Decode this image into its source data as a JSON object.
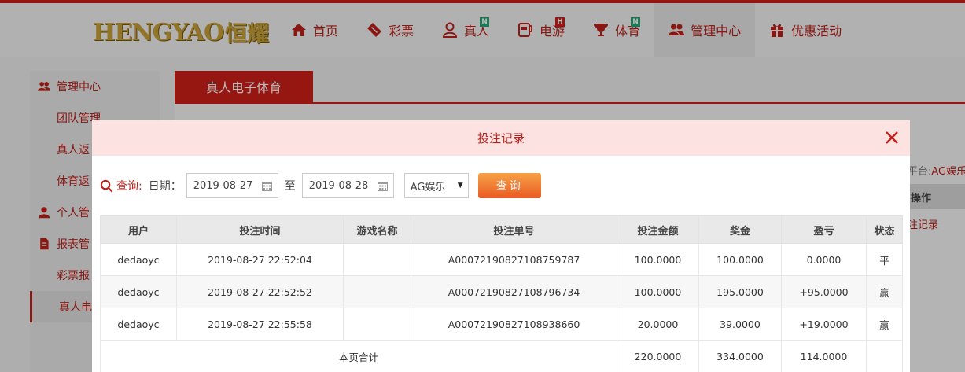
{
  "brand": {
    "logo_en": "HENGYAO",
    "logo_cn": "恒耀"
  },
  "nav": [
    {
      "label": "首页",
      "icon": "home-icon",
      "badge": ""
    },
    {
      "label": "彩票",
      "icon": "ticket-icon",
      "badge": ""
    },
    {
      "label": "真人",
      "icon": "live-dealer-icon",
      "badge": "N"
    },
    {
      "label": "电游",
      "icon": "slot-machine-icon",
      "badge": "H"
    },
    {
      "label": "体育",
      "icon": "trophy-icon",
      "badge": "N"
    },
    {
      "label": "管理中心",
      "icon": "users-icon",
      "badge": ""
    },
    {
      "label": "优惠活动",
      "icon": "gift-icon",
      "badge": ""
    }
  ],
  "sidebar": {
    "items": [
      {
        "label": "管理中心",
        "icon": "users-icon"
      },
      {
        "label": "团队管理"
      },
      {
        "label": "真人返"
      },
      {
        "label": "体育返"
      },
      {
        "label": "个人管",
        "icon": "user-icon"
      },
      {
        "label": "报表管",
        "icon": "report-icon"
      },
      {
        "label": "彩票报"
      },
      {
        "label": "真人电"
      }
    ]
  },
  "main": {
    "tab_label": "真人电子体育",
    "platform_label": "平台:",
    "platform_value": "AG娱乐",
    "col_oper": "操作",
    "row_link": "注记录"
  },
  "modal": {
    "title": "投注记录",
    "query_label": "查询:",
    "date_label": "日期：",
    "date_from": "2019-08-27",
    "date_sep": "至",
    "date_to": "2019-08-28",
    "platform_select": "AG娱乐",
    "search_btn": "查询"
  },
  "table": {
    "headers": [
      "用户",
      "投注时间",
      "游戏名称",
      "投注单号",
      "投注金额",
      "奖金",
      "盈亏",
      "状态"
    ],
    "rows": [
      [
        "dedaoyc",
        "2019-08-27 22:52:04",
        "",
        "A00072190827108759787",
        "100.0000",
        "100.0000",
        "0.0000",
        "平"
      ],
      [
        "dedaoyc",
        "2019-08-27 22:52:52",
        "",
        "A00072190827108796734",
        "100.0000",
        "195.0000",
        "+95.0000",
        "赢"
      ],
      [
        "dedaoyc",
        "2019-08-27 22:55:58",
        "",
        "A00072190827108938660",
        "20.0000",
        "39.0000",
        "+19.0000",
        "赢"
      ]
    ],
    "total": {
      "label": "本页合计",
      "bet": "220.0000",
      "prize": "334.0000",
      "profit": "114.0000"
    }
  },
  "colors": {
    "brand_red": "#d0201a",
    "win_green": "#2e8b2e",
    "modal_header": "#fde2e2"
  }
}
